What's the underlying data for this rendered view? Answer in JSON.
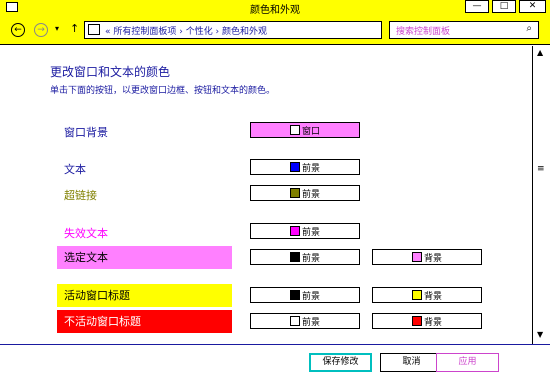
{
  "window": {
    "title": "颜色和外观",
    "controls": {
      "minimize": "—",
      "maximize": "□",
      "close": "✕"
    }
  },
  "nav": {
    "back_glyph": "←",
    "forward_glyph": "→",
    "dropdown_glyph": "▾",
    "up_glyph": "↑",
    "breadcrumb": "«  所有控制面板项  ›  个性化  ›  颜色和外观",
    "address_dropdown": "▾",
    "refresh_glyph": "↻",
    "search_placeholder": "搜索控制面板",
    "search_glyph": "⌕"
  },
  "content": {
    "heading": "更改窗口和文本的颜色",
    "subtext": "单击下面的按钮，以更改窗口边框、按钮和文本的颜色。",
    "labels": {
      "window_bg": "窗口背景",
      "text": "文本",
      "hyperlink": "超链接",
      "disabled_text": "失效文本",
      "selected_text": "选定文本",
      "active_title": "活动窗口标题",
      "inactive_title": "不活动窗口标题"
    },
    "buttons": {
      "window_bg": "窗口",
      "text_fg": "前景",
      "hyperlink_fg": "前景",
      "disabled_fg": "前景",
      "selected_fg": "前景",
      "selected_bg": "背景",
      "active_fg": "前景",
      "active_bg": "背景",
      "inactive_fg": "前景",
      "inactive_bg": "背景"
    }
  },
  "colors": {
    "chrome": "#ffff00",
    "text_blue": "#1a1aa0",
    "hyperlink": "#808000",
    "disabled": "#ff00ff",
    "selected_bg": "#ff80ff",
    "active_title_bg": "#ffff00",
    "inactive_title_bg": "#ff0000",
    "swatch_window": "#ffffff",
    "swatch_text": "#0000ff",
    "swatch_hyperlink": "#808000",
    "swatch_disabled": "#ff00ff",
    "swatch_selected_fg": "#000000",
    "swatch_selected_bg": "#ff80ff",
    "swatch_active_fg": "#000000",
    "swatch_active_bg": "#ffff00",
    "swatch_inactive_fg": "#ffffff",
    "swatch_inactive_bg": "#ff0000"
  },
  "scrollbar": {
    "up": "▲",
    "thumb": "≡",
    "down": "▼"
  },
  "footer": {
    "save": "保存修改",
    "cancel": "取消",
    "apply": "应用"
  }
}
